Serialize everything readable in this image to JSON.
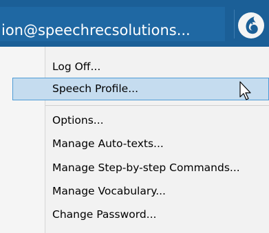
{
  "titlebar": {
    "account_text": "ion@speechrecsolutions...",
    "logo_icon": "dragon-flame-logo",
    "background_color": "#1b5f97"
  },
  "menu": {
    "items": [
      {
        "label": "Log Off..."
      },
      {
        "label": "Speech Profile...",
        "highlighted": true
      },
      {
        "label": "Options..."
      },
      {
        "label": "Manage Auto-texts..."
      },
      {
        "label": "Manage Step-by-step Commands..."
      },
      {
        "label": "Manage Vocabulary..."
      },
      {
        "label": "Change Password..."
      }
    ],
    "highlight_color": "#c5dcef"
  },
  "cursor_icon": "arrow-pointer-icon"
}
